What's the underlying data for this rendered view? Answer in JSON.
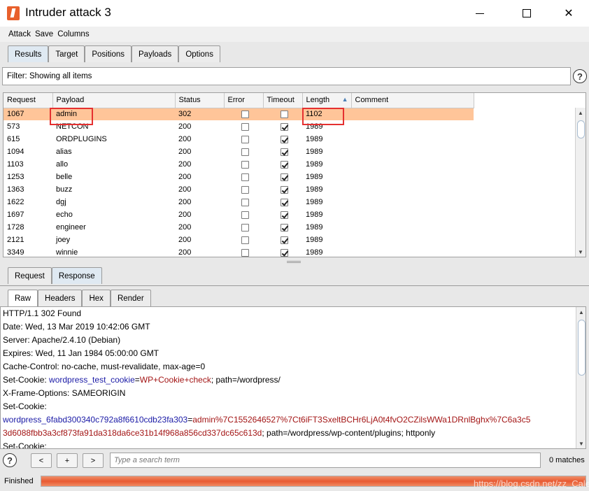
{
  "window": {
    "title": "Intruder attack 3",
    "controls": {
      "minimize": "minimize",
      "maximize": "maximize",
      "close": "✕"
    }
  },
  "menu": [
    "Attack",
    "Save",
    "Columns"
  ],
  "top_tabs": [
    "Results",
    "Target",
    "Positions",
    "Payloads",
    "Options"
  ],
  "top_tabs_active": "Results",
  "filter": {
    "text": "Filter: Showing all items"
  },
  "help_glyph": "?",
  "results_table": {
    "columns": [
      "Request",
      "Payload",
      "Status",
      "Error",
      "Timeout",
      "Length",
      "Comment"
    ],
    "sorted_column": "Length",
    "rows": [
      {
        "request": "1067",
        "payload": "admin",
        "status": "302",
        "error": false,
        "timeout": false,
        "length": "1102",
        "comment": "",
        "selected": true
      },
      {
        "request": "573",
        "payload": "NETCON",
        "status": "200",
        "error": false,
        "timeout": true,
        "length": "1989",
        "comment": ""
      },
      {
        "request": "615",
        "payload": "ORDPLUGINS",
        "status": "200",
        "error": false,
        "timeout": true,
        "length": "1989",
        "comment": ""
      },
      {
        "request": "1094",
        "payload": "alias",
        "status": "200",
        "error": false,
        "timeout": true,
        "length": "1989",
        "comment": ""
      },
      {
        "request": "1103",
        "payload": "allo",
        "status": "200",
        "error": false,
        "timeout": true,
        "length": "1989",
        "comment": ""
      },
      {
        "request": "1253",
        "payload": "belle",
        "status": "200",
        "error": false,
        "timeout": true,
        "length": "1989",
        "comment": ""
      },
      {
        "request": "1363",
        "payload": "buzz",
        "status": "200",
        "error": false,
        "timeout": true,
        "length": "1989",
        "comment": ""
      },
      {
        "request": "1622",
        "payload": "dgj",
        "status": "200",
        "error": false,
        "timeout": true,
        "length": "1989",
        "comment": ""
      },
      {
        "request": "1697",
        "payload": "echo",
        "status": "200",
        "error": false,
        "timeout": true,
        "length": "1989",
        "comment": ""
      },
      {
        "request": "1728",
        "payload": "engineer",
        "status": "200",
        "error": false,
        "timeout": true,
        "length": "1989",
        "comment": ""
      },
      {
        "request": "2121",
        "payload": "joey",
        "status": "200",
        "error": false,
        "timeout": true,
        "length": "1989",
        "comment": ""
      },
      {
        "request": "3349",
        "payload": "winnie",
        "status": "200",
        "error": false,
        "timeout": true,
        "length": "1989",
        "comment": ""
      }
    ]
  },
  "req_resp_tabs": [
    "Request",
    "Response"
  ],
  "req_resp_active": "Response",
  "view_tabs": [
    "Raw",
    "Headers",
    "Hex",
    "Render"
  ],
  "view_active": "Raw",
  "response_lines": [
    [
      {
        "t": "HTTP/1.1 302 Found"
      }
    ],
    [
      {
        "t": "Date: Wed, 13 Mar 2019 10:42:06 GMT"
      }
    ],
    [
      {
        "t": "Server: Apache/2.4.10 (Debian)"
      }
    ],
    [
      {
        "t": "Expires: Wed, 11 Jan 1984 05:00:00 GMT"
      }
    ],
    [
      {
        "t": "Cache-Control: no-cache, must-revalidate, max-age=0"
      }
    ],
    [
      {
        "t": "Set-Cookie: "
      },
      {
        "t": "wordpress_test_cookie",
        "c": "blue"
      },
      {
        "t": "="
      },
      {
        "t": "WP+Cookie+check",
        "c": "red"
      },
      {
        "t": "; path=/wordpress/"
      }
    ],
    [
      {
        "t": "X-Frame-Options: SAMEORIGIN"
      }
    ],
    [
      {
        "t": "Set-Cookie:"
      }
    ],
    [
      {
        "t": "wordpress_6fabd300340c792a8f6610cdb23fa303",
        "c": "blue"
      },
      {
        "t": "="
      },
      {
        "t": "admin%7C1552646527%7Ct6iFT3SxeltBCHr6LjA0t4fvO2CZilsWWa1DRnlBghx%7C6a3c5",
        "c": "red"
      }
    ],
    [
      {
        "t": "3d6088fbb3a3cf873fa91da318da6ce31b14f968a856cd337dc65c613d",
        "c": "red"
      },
      {
        "t": "; path=/wordpress/wp-content/plugins; httponly"
      }
    ],
    [
      {
        "t": "Set-Cookie:"
      }
    ]
  ],
  "search": {
    "prev_label": "<",
    "add_label": "+",
    "next_label": ">",
    "placeholder": "Type a search term",
    "matches": "0 matches"
  },
  "status": {
    "text": "Finished",
    "progress": 1.0,
    "watermark": "https://blog.csdn.net/zz_Caleb"
  },
  "colors": {
    "selected_row": "#ffc599",
    "highlight_box": "#e53030",
    "progress": "#e85a32",
    "cookie_name": "#1a1aa6",
    "cookie_value": "#a31515"
  }
}
